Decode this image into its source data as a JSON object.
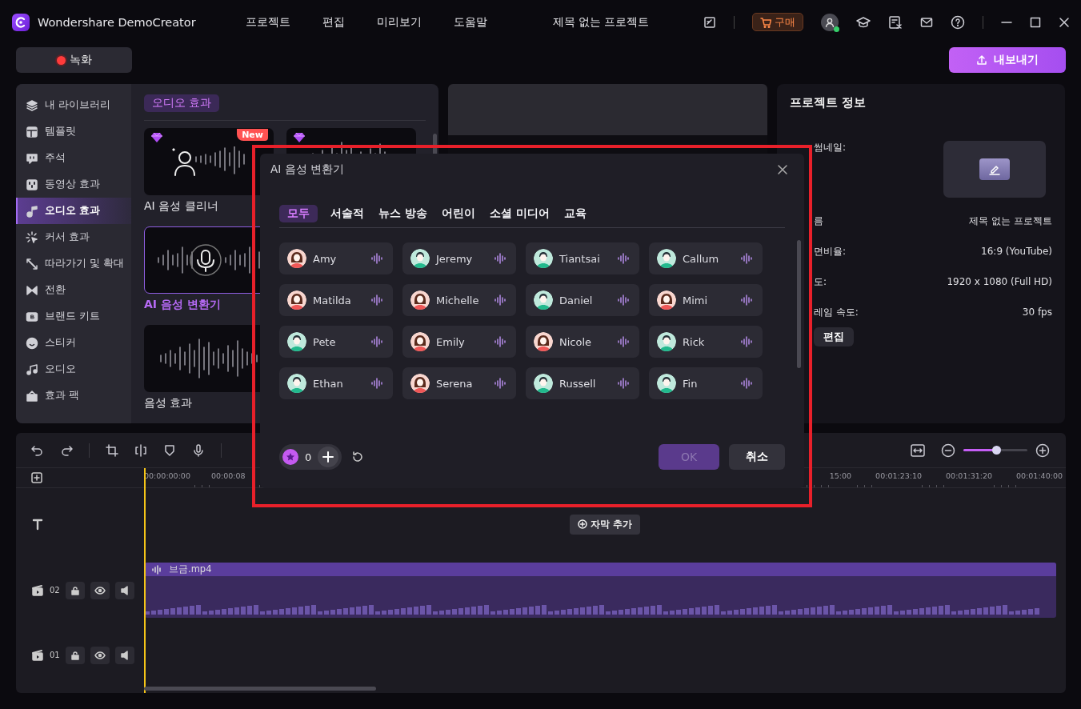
{
  "app": {
    "name": "Wondershare DemoCreator"
  },
  "menu": [
    "프로젝트",
    "편집",
    "미리보기",
    "도움말"
  ],
  "project_title": "제목 없는 프로젝트",
  "buy_button": "구매",
  "record_button": "녹화",
  "export_button": "내보내기",
  "sidebar": {
    "items": [
      {
        "label": "내 라이브러리",
        "selected": false
      },
      {
        "label": "템플릿",
        "selected": false
      },
      {
        "label": "주석",
        "selected": false
      },
      {
        "label": "동영상 효과",
        "selected": false
      },
      {
        "label": "오디오 효과",
        "selected": true
      },
      {
        "label": "커서 효과",
        "selected": false
      },
      {
        "label": "따라가기 및 확대",
        "selected": false
      },
      {
        "label": "전환",
        "selected": false
      },
      {
        "label": "브랜드 키트",
        "selected": false
      },
      {
        "label": "스티커",
        "selected": false
      },
      {
        "label": "오디오",
        "selected": false
      },
      {
        "label": "효과 팩",
        "selected": false
      }
    ]
  },
  "effects": {
    "heading": "오디오 효과",
    "rows": [
      [
        {
          "label": "AI 음성 클리너",
          "premium": true,
          "badge": "New",
          "selected": false
        },
        {
          "premium": true,
          "selected": false
        }
      ],
      [
        {
          "label": "AI 음성 변환기",
          "premium": false,
          "selected": true
        }
      ],
      [
        {
          "label": "음성 효과",
          "premium": false,
          "selected": false
        }
      ]
    ]
  },
  "project_info": {
    "title": "프로젝트 정보",
    "fields": [
      {
        "label": "썸네일:",
        "kind": "thumbnail"
      },
      {
        "label": "름",
        "kind": "text",
        "value": "제목 없는 프로젝트"
      },
      {
        "label": "면비율:",
        "kind": "text",
        "value": "16:9 (YouTube)"
      },
      {
        "label": "도:",
        "kind": "text",
        "value": "1920 x 1080 (Full HD)"
      },
      {
        "label": "레임 속도:",
        "kind": "text",
        "value": "30 fps"
      }
    ],
    "edit_button": "편집"
  },
  "timeline": {
    "zoom": {
      "level": 0.52
    },
    "ruler_left": [
      "00:00:00:00",
      "00:00:08"
    ],
    "ruler_right": [
      "15:00",
      "00:01:23:10",
      "00:01:31:20",
      "00:01:40:00"
    ],
    "add_subtitle": "자막 추가",
    "tracks": [
      {
        "kind": "text"
      },
      {
        "kind": "video",
        "number": "02",
        "clip": "브금.mp4"
      },
      {
        "kind": "video",
        "number": "01"
      }
    ]
  },
  "dialog": {
    "title": "AI 음성 변환기",
    "tabs": [
      {
        "label": "모두",
        "selected": true
      },
      {
        "label": "서술적",
        "selected": false
      },
      {
        "label": "뉴스 방송",
        "selected": false
      },
      {
        "label": "어린이",
        "selected": false
      },
      {
        "label": "소셜 미디어",
        "selected": false
      },
      {
        "label": "교육",
        "selected": false
      }
    ],
    "voices": [
      {
        "name": "Amy",
        "kind": "female"
      },
      {
        "name": "Jeremy",
        "kind": "male"
      },
      {
        "name": "Tiantsai",
        "kind": "male"
      },
      {
        "name": "Callum",
        "kind": "male"
      },
      {
        "name": "Matilda",
        "kind": "female"
      },
      {
        "name": "Michelle",
        "kind": "female"
      },
      {
        "name": "Daniel",
        "kind": "male"
      },
      {
        "name": "Mimi",
        "kind": "female"
      },
      {
        "name": "Pete",
        "kind": "male"
      },
      {
        "name": "Emily",
        "kind": "female"
      },
      {
        "name": "Nicole",
        "kind": "female"
      },
      {
        "name": "Rick",
        "kind": "male"
      },
      {
        "name": "Ethan",
        "kind": "male"
      },
      {
        "name": "Serena",
        "kind": "female"
      },
      {
        "name": "Russell",
        "kind": "male"
      },
      {
        "name": "Fin",
        "kind": "male"
      }
    ],
    "credits": "0",
    "ok": {
      "label": "OK",
      "disabled": true
    },
    "cancel": "취소"
  }
}
